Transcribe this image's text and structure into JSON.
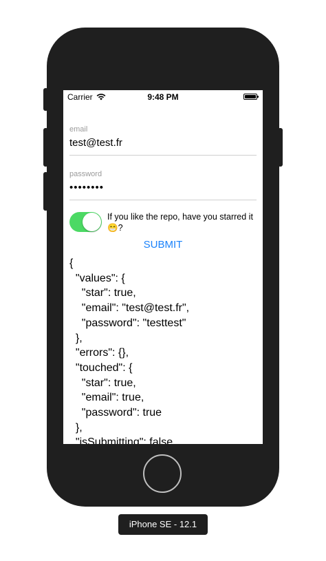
{
  "status_bar": {
    "carrier": "Carrier",
    "time": "9:48 PM"
  },
  "form": {
    "email": {
      "label": "email",
      "value": "test@test.fr"
    },
    "password": {
      "label": "password",
      "value": "••••••••"
    },
    "star_switch": {
      "on": true,
      "color": "#4cd964",
      "text": "If you like the repo, have you starred it 😁?"
    },
    "submit_label": "SUBMIT",
    "accent_color": "#1a82fb"
  },
  "json_output": {
    "lines": [
      "{",
      "  \"values\": {",
      "    \"star\": true,",
      "    \"email\": \"test@test.fr\",",
      "    \"password\": \"testtest\"",
      "  },",
      "  \"errors\": {},",
      "  \"touched\": {",
      "    \"star\": true,",
      "    \"email\": true,",
      "    \"password\": true",
      "  },",
      "  \"isSubmitting\": false,"
    ]
  },
  "device_label": "iPhone SE - 12.1"
}
